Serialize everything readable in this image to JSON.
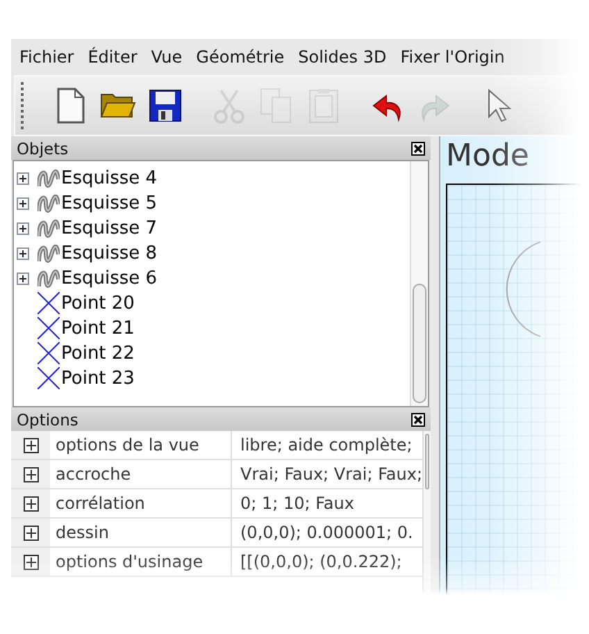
{
  "menu": [
    "Fichier",
    "Éditer",
    "Vue",
    "Géométrie",
    "Solides 3D",
    "Fixer l'Origin"
  ],
  "toolbar": [
    {
      "kind": "new",
      "disabled": false
    },
    {
      "kind": "open",
      "disabled": false
    },
    {
      "kind": "save",
      "disabled": false
    },
    {
      "kind": "cut",
      "disabled": true
    },
    {
      "kind": "copy",
      "disabled": true
    },
    {
      "kind": "paste",
      "disabled": true
    },
    {
      "kind": "undo",
      "disabled": false
    },
    {
      "kind": "redo",
      "disabled": true
    },
    {
      "kind": "pointer",
      "disabled": false
    }
  ],
  "objects_panel": {
    "title": "Objets",
    "items": [
      {
        "kind": "sketch",
        "label": "Esquisse 4",
        "expanded": false
      },
      {
        "kind": "sketch",
        "label": "Esquisse 5",
        "expanded": false
      },
      {
        "kind": "sketch",
        "label": "Esquisse 7",
        "expanded": false
      },
      {
        "kind": "sketch",
        "label": "Esquisse 8",
        "expanded": false
      },
      {
        "kind": "sketch",
        "label": "Esquisse 6",
        "expanded": false
      },
      {
        "kind": "point",
        "label": "Point 20"
      },
      {
        "kind": "point",
        "label": "Point 21"
      },
      {
        "kind": "point",
        "label": "Point 22"
      },
      {
        "kind": "point",
        "label": "Point 23"
      }
    ]
  },
  "options_panel": {
    "title": "Options",
    "rows": [
      {
        "name": "options de la vue",
        "value": "libre; aide complète;",
        "expanded": false
      },
      {
        "name": "accroche",
        "value": "Vrai; Faux; Vrai; Faux;",
        "expanded": false
      },
      {
        "name": "corrélation",
        "value": "0; 1; 10; Faux",
        "expanded": false
      },
      {
        "name": "dessin",
        "value": "(0,0,0); 0.000001; 0.",
        "expanded": false
      },
      {
        "name": "options d'usinage",
        "value": "[[(0,0,0); (0,0.222);",
        "expanded": false
      }
    ]
  },
  "view": {
    "title": "Mode"
  }
}
